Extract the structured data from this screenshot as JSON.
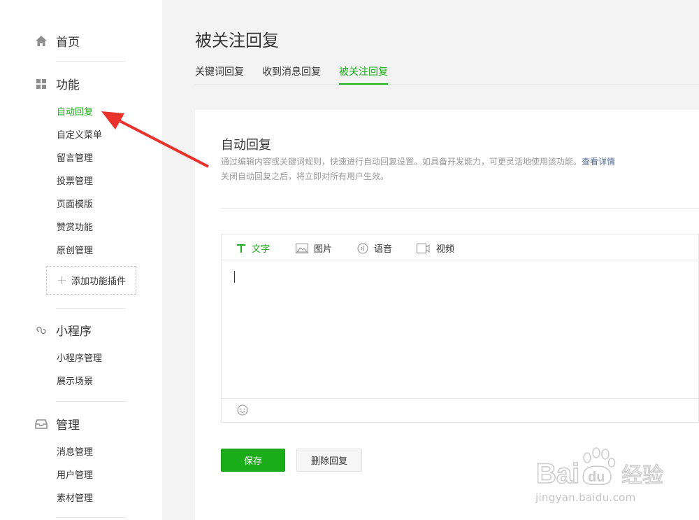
{
  "sidebar": {
    "home": {
      "label": "首页",
      "icon": "home-icon"
    },
    "functions": {
      "label": "功能",
      "icon": "grid-icon",
      "items": [
        "自动回复",
        "自定义菜单",
        "留言管理",
        "投票管理",
        "页面模版",
        "赞赏功能",
        "原创管理"
      ],
      "add_plugin": "添加功能插件"
    },
    "miniprogram": {
      "label": "小程序",
      "icon": "link-icon",
      "items": [
        "小程序管理",
        "展示场景"
      ]
    },
    "manage": {
      "label": "管理",
      "icon": "inbox-icon",
      "items": [
        "消息管理",
        "用户管理",
        "素材管理"
      ]
    }
  },
  "page": {
    "title": "被关注回复",
    "tabs": [
      "关键词回复",
      "收到消息回复",
      "被关注回复"
    ],
    "active_tab": "被关注回复"
  },
  "card": {
    "title": "自动回复",
    "desc_line1": "通过编辑内容或关键词规则，快速进行自动回复设置。如具备开发能力，可更灵活地使用该功能。",
    "desc_link": "查看详情",
    "desc_line2": "关闭自动回复之后，将立即对所有用户生效。",
    "toolbar": [
      {
        "label": "文字",
        "icon": "text-icon"
      },
      {
        "label": "图片",
        "icon": "image-icon"
      },
      {
        "label": "语音",
        "icon": "voice-icon"
      },
      {
        "label": "视频",
        "icon": "video-icon"
      }
    ],
    "save_label": "保存",
    "delete_label": "删除回复"
  },
  "watermark": {
    "brand": "Baidu",
    "brand_cn": "经验",
    "url": "jingyan.baidu.com"
  },
  "colors": {
    "accent": "#1aad19",
    "link": "#576b95",
    "annotation_arrow": "#e8322b"
  }
}
